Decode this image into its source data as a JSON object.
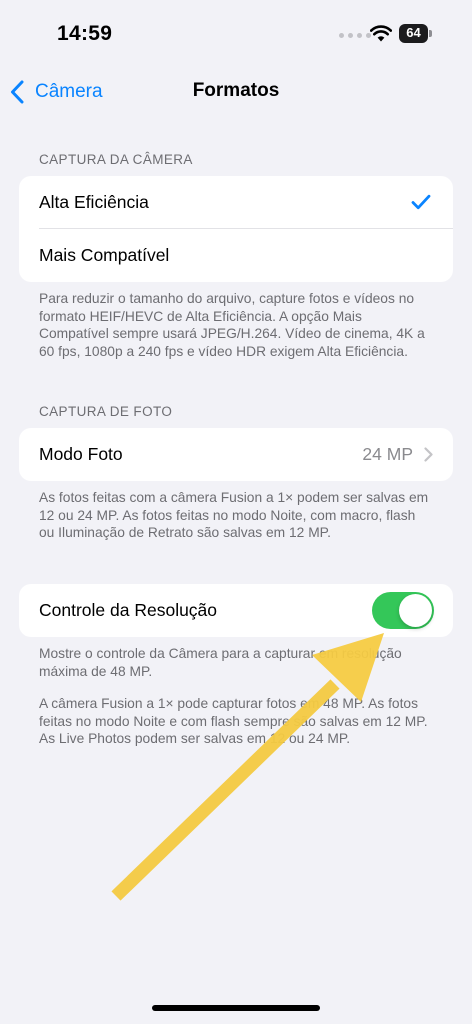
{
  "status_bar": {
    "time": "14:59",
    "battery_level": "64"
  },
  "nav": {
    "back_label": "Câmera",
    "title": "Formatos",
    "accent_color": "#0A84FF"
  },
  "camera_capture": {
    "header": "CAPTURA DA CÂMERA",
    "options": [
      {
        "label": "Alta Eficiência",
        "selected": true
      },
      {
        "label": "Mais Compatível",
        "selected": false
      }
    ],
    "footer": "Para reduzir o tamanho do arquivo, capture fotos e vídeos no formato HEIF/HEVC de Alta Eficiência. A opção Mais Compatível sempre usará JPEG/H.264. Vídeo de cinema, 4K a 60 fps, 1080p a 240 fps e vídeo HDR exigem Alta Eficiência."
  },
  "photo_capture": {
    "header": "CAPTURA DE FOTO",
    "photo_mode_label": "Modo Foto",
    "photo_mode_value": "24 MP",
    "footer": "As fotos feitas com a câmera Fusion a 1× podem ser salvas em 12 ou 24 MP. As fotos feitas no modo Noite, com macro, flash ou Iluminação de Retrato são salvas em 12 MP."
  },
  "resolution_control": {
    "label": "Controle da Resolução",
    "enabled": true,
    "toggle_color": "#34C759",
    "footer_1": "Mostre o controle da Câmera para a capturar em resolução máxima de 48 MP.",
    "footer_2": "A câmera Fusion a 1× pode capturar fotos em 48 MP. As fotos feitas no modo Noite e com flash sempre são salvas em 12 MP. As Live Photos podem ser salvas em 12 ou 24 MP."
  },
  "annotation": {
    "arrow_color": "#F5CB42"
  }
}
